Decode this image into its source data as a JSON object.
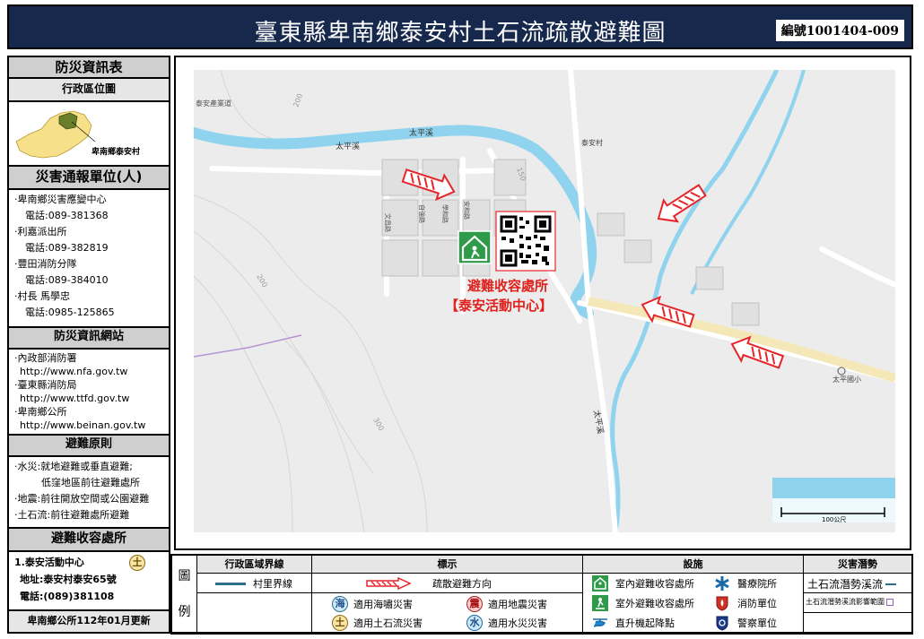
{
  "header": {
    "title": "臺東縣卑南鄉泰安村土石流疏散避難圖",
    "doc_number": "編號1001404-009"
  },
  "sidebar": {
    "info_title": "防災資訊表",
    "admin_map_title": "行政區位圖",
    "admin_map_label": "卑南鄉泰安村",
    "report_title": "災害通報單位(人)",
    "report_lines": [
      "‧卑南鄉災害應變中心",
      "電話:089-381368",
      "‧利嘉派出所",
      "電話:089-382819",
      "‧豐田消防分隊",
      "電話:089-384010",
      "‧村長 馬學忠",
      "電話:0985-125865"
    ],
    "web_title": "防災資訊網站",
    "web_lines": [
      "‧內政部消防署",
      "http://www.nfa.gov.tw",
      "‧臺東縣消防局",
      "http://www.ttfd.gov.tw",
      "‧卑南鄉公所",
      "http://www.beinan.gov.tw"
    ],
    "principle_title": "避難原則",
    "principle_lines": [
      "‧水災:就地避難或垂直避難;",
      "低窪地區前往避難處所",
      "‧地震:前往開放空間或公園避難",
      "‧土石流:前往避難處所避難"
    ],
    "shelter_title": "避難收容處所",
    "shelter_name": "1.泰安活動中心",
    "shelter_badge": "土",
    "shelter_address": "地址:泰安村泰安65號",
    "shelter_phone": "電話:(089)381108",
    "updated": "卑南鄉公所112年01月更新"
  },
  "map": {
    "shelter_label_1": "避難收容處所",
    "shelter_label_2": "【泰安活動中心】",
    "river_name_1": "太平溪",
    "river_name_2": "太平溪",
    "river_name_3": "太平溪",
    "village_label": "泰安村",
    "school_label": "太平國小",
    "top_left_label": "泰安產業道",
    "road_label_1": "200",
    "road_label_2": "150",
    "road_label_3": "200",
    "road_label_4": "300",
    "street_1": "文昌路",
    "street_2": "自強路",
    "street_3": "學和路",
    "street_4": "安和路",
    "scale_label": "100公尺"
  },
  "legend": {
    "side_label_1": "圖",
    "side_label_2": "例",
    "admin_header": "行政區域界線",
    "admin_item": "村里界線",
    "sign_header": "標示",
    "sign_item": "疏散避難方向",
    "hazard_sea": "適用海嘯災害",
    "hazard_quake": "適用地震災害",
    "hazard_debris": "適用土石流災害",
    "hazard_flood": "適用水災災害",
    "sea_glyph": "海",
    "quake_glyph": "震",
    "debris_glyph": "土",
    "flood_glyph": "水",
    "facility_header": "設施",
    "indoor_shelter": "室內避難收容處所",
    "outdoor_shelter": "室外避難收容處所",
    "heliport": "直升機起降點",
    "hospital": "醫療院所",
    "fire_unit": "消防單位",
    "police_unit": "警察單位",
    "potential_header": "災害潛勢",
    "potential_stream": "土石流潛勢溪流",
    "potential_zone": "土石流潛勢溪流影響範圍"
  },
  "colors": {
    "banner": "#17284d",
    "river": "#8fd3ee",
    "arrow": "#e5252a",
    "shelter_green": "#2e9a4a",
    "label_red": "#e0201c",
    "admin_line": "#2a6f8a",
    "potential_purple": "#9a5fb5"
  }
}
